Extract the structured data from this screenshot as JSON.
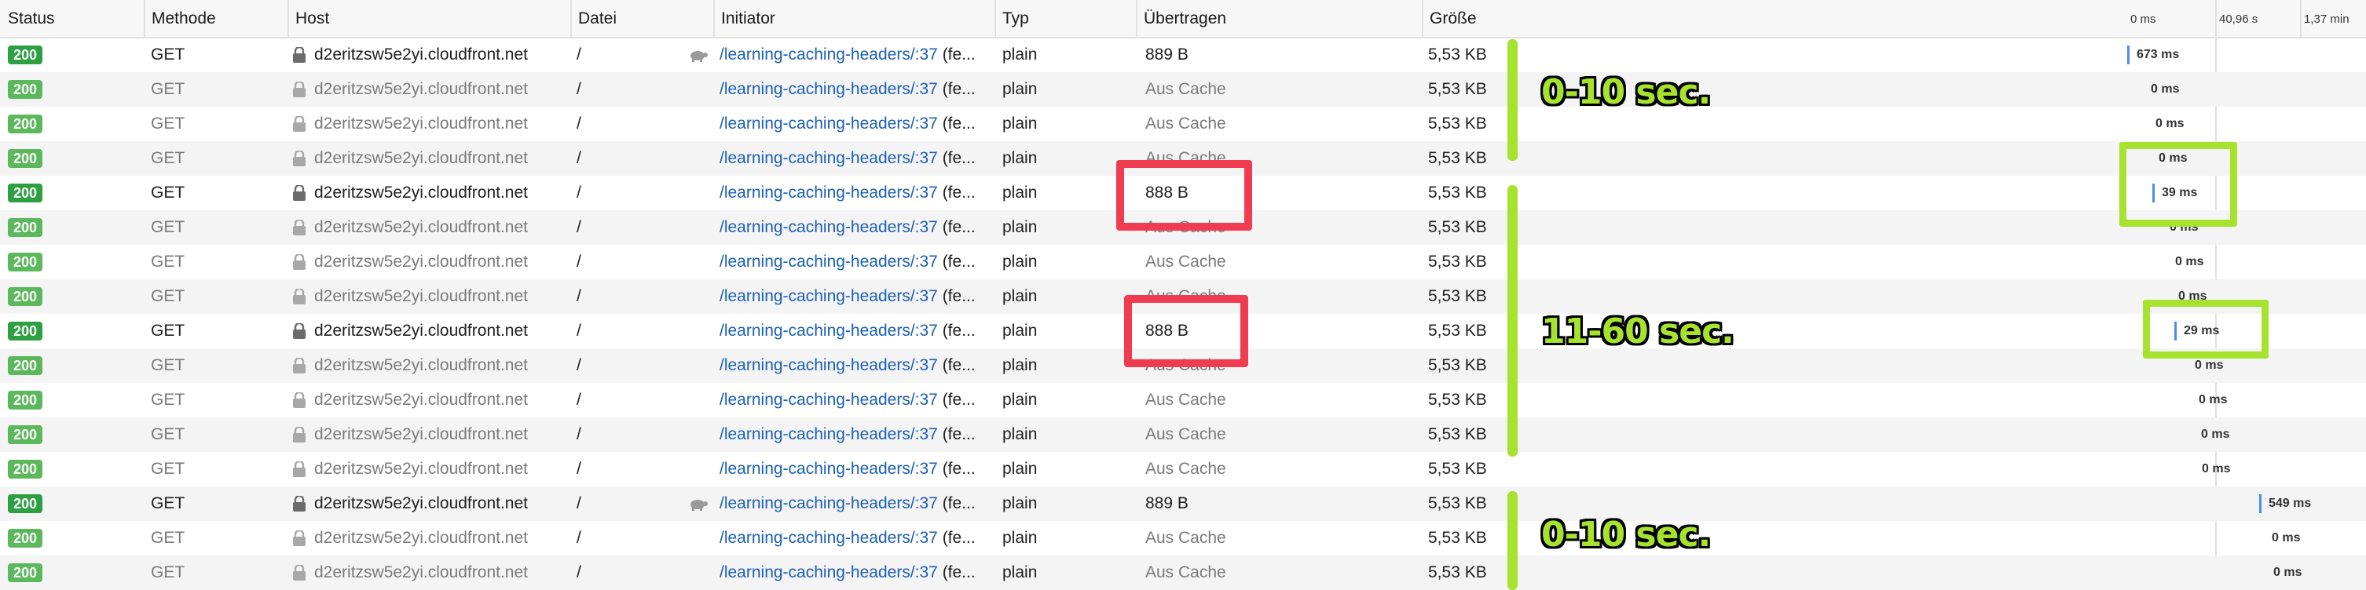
{
  "columns": {
    "status": "Status",
    "method": "Methode",
    "host": "Host",
    "file": "Datei",
    "initiator": "Initiator",
    "type": "Typ",
    "transferred": "Übertragen",
    "size": "Größe"
  },
  "timeline_ticks": [
    "0 ms",
    "40,96 s",
    "1,37 min"
  ],
  "rows": [
    {
      "status": "200",
      "method": "GET",
      "host": "d2eritzsw5e2yi.cloudfront.net",
      "file": "/",
      "initiator": "/learning-caching-headers/:37",
      "initiator_suffix": "(fe...",
      "type": "plain",
      "transferred": "889 B",
      "size": "5,53 KB",
      "timing": "673 ms",
      "cached": false,
      "turtle": true
    },
    {
      "status": "200",
      "method": "GET",
      "host": "d2eritzsw5e2yi.cloudfront.net",
      "file": "/",
      "initiator": "/learning-caching-headers/:37",
      "initiator_suffix": "(fe...",
      "type": "plain",
      "transferred": "Aus Cache",
      "size": "5,53 KB",
      "timing": "0 ms",
      "cached": true,
      "turtle": false
    },
    {
      "status": "200",
      "method": "GET",
      "host": "d2eritzsw5e2yi.cloudfront.net",
      "file": "/",
      "initiator": "/learning-caching-headers/:37",
      "initiator_suffix": "(fe...",
      "type": "plain",
      "transferred": "Aus Cache",
      "size": "5,53 KB",
      "timing": "0 ms",
      "cached": true,
      "turtle": false
    },
    {
      "status": "200",
      "method": "GET",
      "host": "d2eritzsw5e2yi.cloudfront.net",
      "file": "/",
      "initiator": "/learning-caching-headers/:37",
      "initiator_suffix": "(fe...",
      "type": "plain",
      "transferred": "Aus Cache",
      "size": "5,53 KB",
      "timing": "0 ms",
      "cached": true,
      "turtle": false
    },
    {
      "status": "200",
      "method": "GET",
      "host": "d2eritzsw5e2yi.cloudfront.net",
      "file": "/",
      "initiator": "/learning-caching-headers/:37",
      "initiator_suffix": "(fe...",
      "type": "plain",
      "transferred": "888 B",
      "size": "5,53 KB",
      "timing": "39 ms",
      "cached": false,
      "turtle": false
    },
    {
      "status": "200",
      "method": "GET",
      "host": "d2eritzsw5e2yi.cloudfront.net",
      "file": "/",
      "initiator": "/learning-caching-headers/:37",
      "initiator_suffix": "(fe...",
      "type": "plain",
      "transferred": "Aus Cache",
      "size": "5,53 KB",
      "timing": "0 ms",
      "cached": true,
      "turtle": false
    },
    {
      "status": "200",
      "method": "GET",
      "host": "d2eritzsw5e2yi.cloudfront.net",
      "file": "/",
      "initiator": "/learning-caching-headers/:37",
      "initiator_suffix": "(fe...",
      "type": "plain",
      "transferred": "Aus Cache",
      "size": "5,53 KB",
      "timing": "0 ms",
      "cached": true,
      "turtle": false
    },
    {
      "status": "200",
      "method": "GET",
      "host": "d2eritzsw5e2yi.cloudfront.net",
      "file": "/",
      "initiator": "/learning-caching-headers/:37",
      "initiator_suffix": "(fe...",
      "type": "plain",
      "transferred": "Aus Cache",
      "size": "5,53 KB",
      "timing": "0 ms",
      "cached": true,
      "turtle": false
    },
    {
      "status": "200",
      "method": "GET",
      "host": "d2eritzsw5e2yi.cloudfront.net",
      "file": "/",
      "initiator": "/learning-caching-headers/:37",
      "initiator_suffix": "(fe...",
      "type": "plain",
      "transferred": "888 B",
      "size": "5,53 KB",
      "timing": "29 ms",
      "cached": false,
      "turtle": false
    },
    {
      "status": "200",
      "method": "GET",
      "host": "d2eritzsw5e2yi.cloudfront.net",
      "file": "/",
      "initiator": "/learning-caching-headers/:37",
      "initiator_suffix": "(fe...",
      "type": "plain",
      "transferred": "Aus Cache",
      "size": "5,53 KB",
      "timing": "0 ms",
      "cached": true,
      "turtle": false
    },
    {
      "status": "200",
      "method": "GET",
      "host": "d2eritzsw5e2yi.cloudfront.net",
      "file": "/",
      "initiator": "/learning-caching-headers/:37",
      "initiator_suffix": "(fe...",
      "type": "plain",
      "transferred": "Aus Cache",
      "size": "5,53 KB",
      "timing": "0 ms",
      "cached": true,
      "turtle": false
    },
    {
      "status": "200",
      "method": "GET",
      "host": "d2eritzsw5e2yi.cloudfront.net",
      "file": "/",
      "initiator": "/learning-caching-headers/:37",
      "initiator_suffix": "(fe...",
      "type": "plain",
      "transferred": "Aus Cache",
      "size": "5,53 KB",
      "timing": "0 ms",
      "cached": true,
      "turtle": false
    },
    {
      "status": "200",
      "method": "GET",
      "host": "d2eritzsw5e2yi.cloudfront.net",
      "file": "/",
      "initiator": "/learning-caching-headers/:37",
      "initiator_suffix": "(fe...",
      "type": "plain",
      "transferred": "Aus Cache",
      "size": "5,53 KB",
      "timing": "0 ms",
      "cached": true,
      "turtle": false
    },
    {
      "status": "200",
      "method": "GET",
      "host": "d2eritzsw5e2yi.cloudfront.net",
      "file": "/",
      "initiator": "/learning-caching-headers/:37",
      "initiator_suffix": "(fe...",
      "type": "plain",
      "transferred": "889 B",
      "size": "5,53 KB",
      "timing": "549 ms",
      "cached": false,
      "turtle": true
    },
    {
      "status": "200",
      "method": "GET",
      "host": "d2eritzsw5e2yi.cloudfront.net",
      "file": "/",
      "initiator": "/learning-caching-headers/:37",
      "initiator_suffix": "(fe...",
      "type": "plain",
      "transferred": "Aus Cache",
      "size": "5,53 KB",
      "timing": "0 ms",
      "cached": true,
      "turtle": false
    },
    {
      "status": "200",
      "method": "GET",
      "host": "d2eritzsw5e2yi.cloudfront.net",
      "file": "/",
      "initiator": "/learning-caching-headers/:37",
      "initiator_suffix": "(fe...",
      "type": "plain",
      "transferred": "Aus Cache",
      "size": "5,53 KB",
      "timing": "0 ms",
      "cached": true,
      "turtle": false
    }
  ],
  "annotations": {
    "label_1": "0-10 sec.",
    "label_2": "11-60 sec.",
    "label_3": "0-10 sec.",
    "highlight_color": "#a6e22e",
    "alert_color": "#f03c50"
  }
}
